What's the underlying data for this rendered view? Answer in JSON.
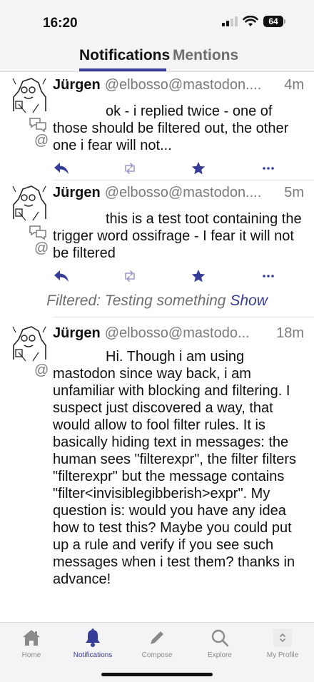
{
  "status": {
    "time": "16:20",
    "battery": "64",
    "signal_icon": "cellular-signal-icon",
    "wifi_icon": "wifi-icon",
    "battery_icon": "battery-icon"
  },
  "tabs": [
    {
      "label": "Notifications",
      "active": true
    },
    {
      "label": "Mentions",
      "active": false
    }
  ],
  "posts": [
    {
      "author": "Jürgen",
      "handle": "@elbosso@mastodon....",
      "time": "4m",
      "text": "ok - i replied twice - one of those should be filtered out, the other one i fear will not..."
    },
    {
      "author": "Jürgen",
      "handle": "@elbosso@mastodon....",
      "time": "5m",
      "text": "this is a test toot containing the trigger word ossifrage - I fear it will not be filtered"
    },
    {
      "author": "Jürgen",
      "handle": "@elbosso@mastodo...",
      "time": "18m",
      "text": "Hi. Though i am using mastodon since way back, i am unfamiliar with blocking and filtering. I suspect just discovered a way, that would allow to fool filter rules. It is basically hiding text in messages: the human sees \"filterexpr\", the filter filters \"filterexpr\" but the message contains \"filter<invisiblegibberish>expr\". My question is: would you have any idea how to test this? Maybe you could put up a rule and verify if you see such messages when i test them? thanks in advance!"
    }
  ],
  "filtered_notice": {
    "text": "Filtered: Testing something",
    "action": "Show"
  },
  "bottom_nav": [
    {
      "label": "Home",
      "icon": "home-icon"
    },
    {
      "label": "Notifications",
      "icon": "bell-icon",
      "active": true
    },
    {
      "label": "Compose",
      "icon": "pencil-icon"
    },
    {
      "label": "Explore",
      "icon": "search-icon"
    },
    {
      "label": "My Profile",
      "icon": "sort-chevrons-icon"
    }
  ],
  "colors": {
    "accent": "#373c98",
    "muted": "#7a7a7a",
    "bar_background": "#f4f4f6"
  }
}
